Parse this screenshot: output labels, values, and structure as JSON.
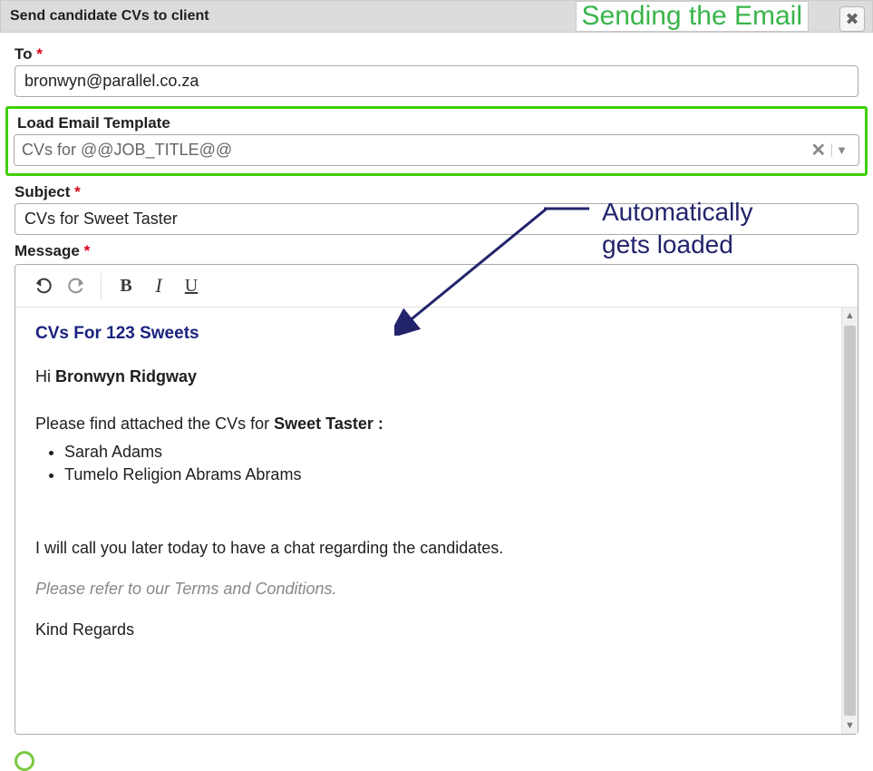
{
  "dialog": {
    "title": "Send candidate CVs to client"
  },
  "annotations": {
    "banner": "Sending the Email",
    "autoload": "Automatically\ngets loaded"
  },
  "fields": {
    "to": {
      "label": "To",
      "value": "bronwyn@parallel.co.za"
    },
    "template": {
      "label": "Load Email Template",
      "value": "CVs for @@JOB_TITLE@@"
    },
    "subject": {
      "label": "Subject",
      "value": "CVs for Sweet Taster"
    },
    "message": {
      "label": "Message"
    }
  },
  "editor": {
    "heading": "CVs For 123 Sweets",
    "greeting_prefix": "Hi ",
    "greeting_name": "Bronwyn Ridgway",
    "intro_prefix": "Please find attached the CVs for ",
    "intro_job": "Sweet Taster :",
    "candidates": [
      "Sarah Adams",
      "Tumelo Religion Abrams Abrams"
    ],
    "followup": "I will call you later today to have a chat regarding the candidates.",
    "terms": "Please refer to our Terms and Conditions.",
    "signoff": "Kind Regards"
  }
}
